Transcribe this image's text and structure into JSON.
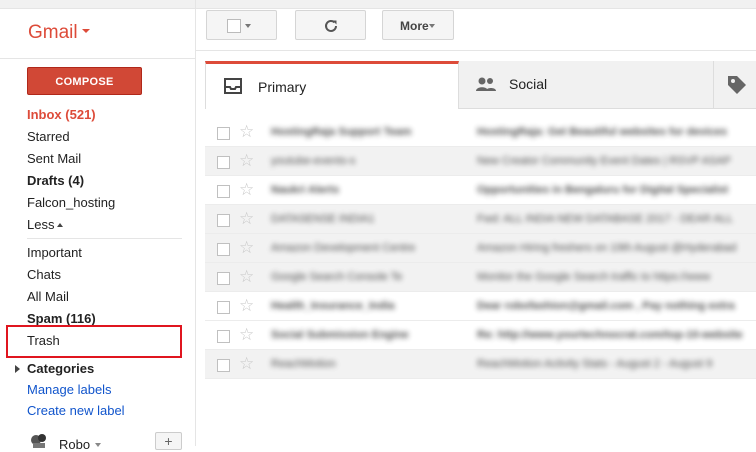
{
  "app": {
    "logo_label": "Gmail"
  },
  "sidebar": {
    "compose_label": "COMPOSE",
    "items": [
      {
        "label": "Inbox (521)"
      },
      {
        "label": "Starred"
      },
      {
        "label": "Sent Mail"
      },
      {
        "label": "Drafts (4)"
      },
      {
        "label": "Falcon_hosting"
      },
      {
        "label": "Less"
      },
      {
        "label": "Important"
      },
      {
        "label": "Chats"
      },
      {
        "label": "All Mail"
      },
      {
        "label": "Spam (116)"
      },
      {
        "label": "Trash"
      },
      {
        "label": "Categories"
      },
      {
        "label": "Manage labels"
      },
      {
        "label": "Create new label"
      }
    ],
    "hangouts_user": "Robo",
    "add_label": "+"
  },
  "toolbar": {
    "more_label": "More"
  },
  "tabs": [
    {
      "label": "Primary",
      "icon": "inbox-icon"
    },
    {
      "label": "Social",
      "icon": "people-icon"
    },
    {
      "label": "",
      "icon": "tag-icon"
    }
  ],
  "accent_color": "#dd4b39",
  "highlight_color": "#e0151f",
  "mail_rows": [
    {
      "sender": "HostingRaja Support Team",
      "subject": "HostingRaja: Get Beautiful websites for devices"
    },
    {
      "sender": "youtube-events-s",
      "subject": "New Creator Community Event Dates | RSVP ASAP"
    },
    {
      "sender": "Naukri Alerts",
      "subject": "Opportunities in Bengaluru for Digital Specialist"
    },
    {
      "sender": "DATASENSE INDIA1",
      "subject": "Fwd: ALL INDIA NEW DATABASE 2017 - DEAR ALL"
    },
    {
      "sender": "Amazon Development Centre",
      "subject": "Amazon Hiring freshers on 19th August @Hyderabad"
    },
    {
      "sender": "Google Search Console Te",
      "subject": "Monitor the Google Search traffic to https://www"
    },
    {
      "sender": "Health_Insurance_India",
      "subject": "Dear robofashion@gmail.com , Pay nothing extra"
    },
    {
      "sender": "Social Submission Engine",
      "subject": "Re: http://www.yourtechnocrat.com/top-10-website"
    },
    {
      "sender": "ReachMotion",
      "subject": "ReachMotion Activity Stats - August 2 - August 9"
    }
  ]
}
